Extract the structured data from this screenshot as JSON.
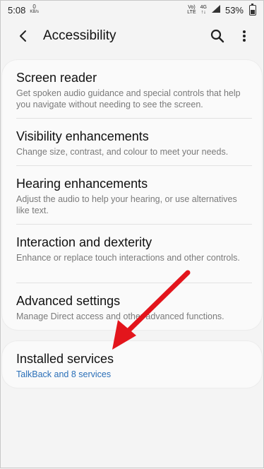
{
  "status_bar": {
    "time": "5:08",
    "data_speed": "0",
    "data_unit": "KB/s",
    "volte": "Vo)\nLTE",
    "network": "4G",
    "battery": "53%"
  },
  "app_bar": {
    "title": "Accessibility"
  },
  "menu": {
    "items": [
      {
        "title": "Screen reader",
        "description": "Get spoken audio guidance and special controls that help you navigate without needing to see the screen."
      },
      {
        "title": "Visibility enhancements",
        "description": "Change size, contrast, and colour to meet your needs."
      },
      {
        "title": "Hearing enhancements",
        "description": "Adjust the audio to help your hearing, or use alternatives like text."
      },
      {
        "title": "Interaction and dexterity",
        "description": "Enhance or replace touch interactions and other controls."
      },
      {
        "title": "Advanced settings",
        "description": "Manage Direct access and other advanced functions."
      }
    ]
  },
  "installed": {
    "title": "Installed services",
    "subtitle": "TalkBack and 8 services"
  },
  "colors": {
    "accent_link": "#2a6fb8",
    "annotation_arrow": "#e3151c"
  }
}
